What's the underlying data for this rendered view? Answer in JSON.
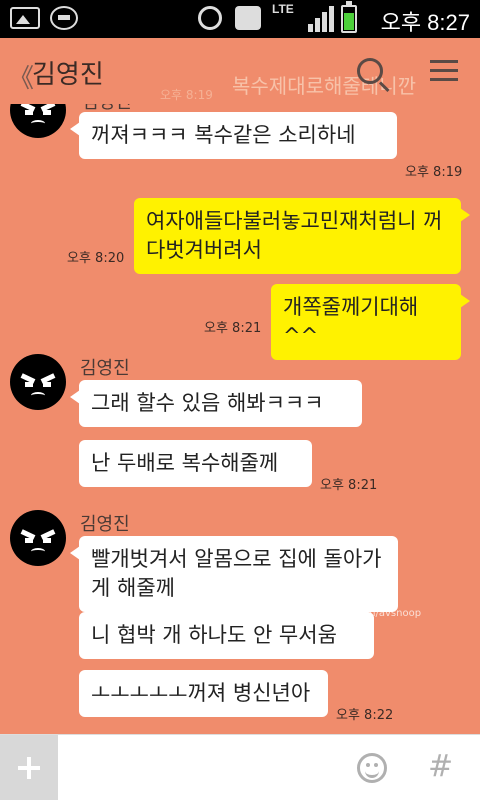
{
  "status_bar": {
    "network": "LTE",
    "time": "오후 8:27"
  },
  "header": {
    "title": "김영진",
    "back_symbol": "《",
    "ghost_text": "복수제대로해줄테니깐",
    "ghost_time": "오후 8:19"
  },
  "messages": [
    {
      "text": "꺼져ㅋㅋㅋ 복수같은 소리하네",
      "time": "오후 8:19"
    },
    {
      "text": "여자애들다불러놓고민재처럼니 꺼다벗겨버려서",
      "time": "오후 8:20"
    },
    {
      "text": "개쪽줄께기대해^^",
      "time": "오후 8:21"
    },
    {
      "sender": "김영진",
      "text": "그래 할수 있음 해봐ㅋㅋㅋ"
    },
    {
      "text": "난 두배로 복수해줄께",
      "time": "오후 8:21"
    },
    {
      "sender": "김영진",
      "text": "빨개벗겨서 알몸으로 집에 돌아가게 해줄께"
    },
    {
      "text": "니 협박 개 하나도 안 무서움"
    },
    {
      "text": "ㅗㅗㅗㅗㅗ꺼져 병신년아",
      "time": "오후 8:22"
    }
  ],
  "sender_first": "김영진",
  "watermark": {
    "brand": "AVSNOOP",
    "url": "www.avsnoop.com/avsnoop"
  },
  "input": {
    "placeholder": "",
    "hash": "#"
  },
  "icons": [
    "gallery-icon",
    "chat-icon",
    "alarm-icon",
    "mute-icon",
    "signal-icon",
    "battery-icon",
    "back-icon",
    "search-icon",
    "menu-icon",
    "avatar-icon",
    "plus-icon",
    "emoji-icon",
    "hash-icon"
  ],
  "colors": {
    "background": "#f08c6c",
    "incoming": "#ffffff",
    "outgoing": "#fff200"
  }
}
